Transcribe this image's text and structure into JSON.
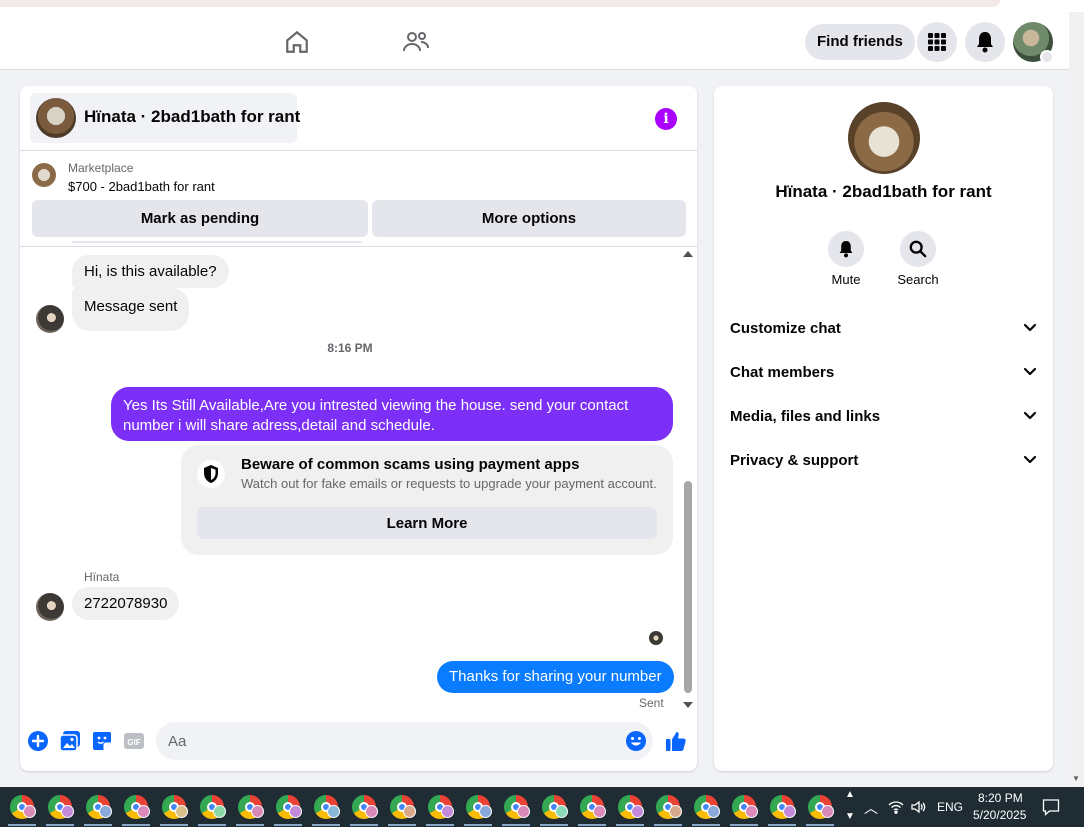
{
  "nav": {
    "find_friends_label": "Find friends"
  },
  "chat": {
    "title": "Hïnata · 2bad1bath for rant",
    "marketplace_label": "Marketplace",
    "listing": "$700 - 2bad1bath for rant",
    "mark_pending_label": "Mark as pending",
    "more_options_label": "More options"
  },
  "messages": {
    "incoming_1": "Hi, is this available?",
    "incoming_2": "Message sent",
    "time_divider": "8:16 PM",
    "outgoing_1_line1": "Yes Its Still Available,Are you intrested viewing the house. send your contact",
    "outgoing_1_line2": "number i will share adress,detail and schedule.",
    "scam_title": "Beware of common scams using payment apps",
    "scam_subtitle": "Watch out for fake emails or requests to upgrade your payment account.",
    "learn_more_label": "Learn More",
    "sender_name": "Hïnata",
    "incoming_3": "2722078930",
    "outgoing_2": "Thanks for sharing your number",
    "status": "Sent"
  },
  "composer": {
    "placeholder": "Aa"
  },
  "details": {
    "title": "Hïnata · 2bad1bath for rant",
    "mute_label": "Mute",
    "search_label": "Search",
    "rows": [
      "Customize chat",
      "Chat members",
      "Media, files and links",
      "Privacy & support"
    ]
  },
  "taskbar": {
    "language": "ENG",
    "time": "8:20 PM",
    "date": "5/20/2025"
  },
  "colors": {
    "accent_purple": "#7b2ff7",
    "accent_blue": "#0a7cff",
    "messenger_blue": "#0866ff",
    "info_purple": "#aa00ff"
  }
}
